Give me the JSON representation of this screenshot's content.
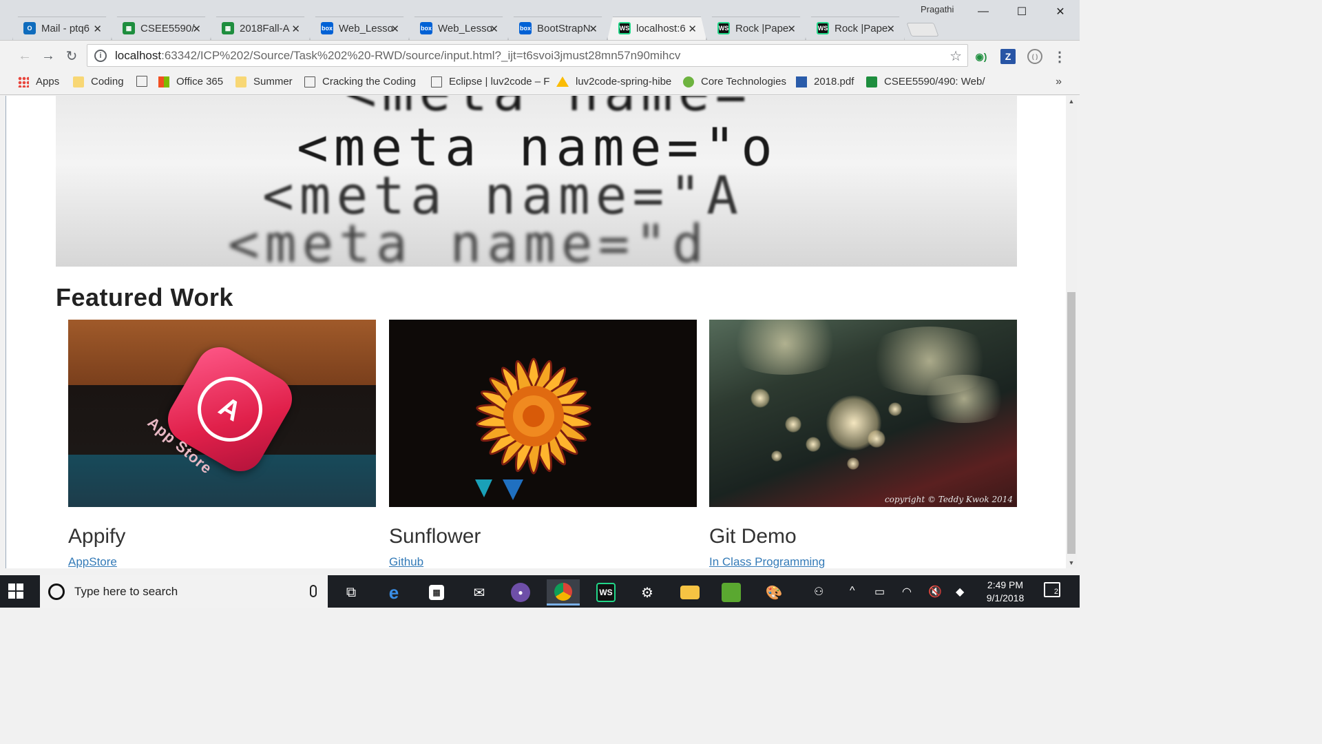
{
  "browser": {
    "profile_name": "Pragathi",
    "tabs": [
      {
        "title": "Mail - ptq6",
        "favicon": "outlook-icon"
      },
      {
        "title": "CSEE5590/",
        "favicon": "google-sheets-icon"
      },
      {
        "title": "2018Fall-A",
        "favicon": "google-sheets-icon"
      },
      {
        "title": "Web_Lesso",
        "favicon": "box-icon"
      },
      {
        "title": "Web_Lesso",
        "favicon": "box-icon"
      },
      {
        "title": "BootStrapN",
        "favicon": "box-icon"
      },
      {
        "title": "localhost:6",
        "favicon": "webstorm-icon"
      },
      {
        "title": "Rock |Pape",
        "favicon": "webstorm-icon"
      },
      {
        "title": "Rock |Pape",
        "favicon": "webstorm-icon"
      }
    ],
    "active_tab_index": 6,
    "url_host": "localhost",
    "url_rest": ":63342/ICP%202/Source/Task%202%20-RWD/source/input.html?_ijt=t6svoi3jmust28mn57n90mihcv",
    "bookmarks": [
      {
        "label": "Apps",
        "icon": "apps-grid-icon"
      },
      {
        "label": "Coding",
        "icon": "folder-icon"
      },
      {
        "label": "",
        "icon": "page-icon"
      },
      {
        "label": "Office 365",
        "icon": "office-icon"
      },
      {
        "label": "Summer",
        "icon": "folder-icon"
      },
      {
        "label": "Cracking the Coding",
        "icon": "page-icon"
      },
      {
        "label": "Eclipse | luv2code – F",
        "icon": "page-icon"
      },
      {
        "label": "luv2code-spring-hibe",
        "icon": "google-drive-icon"
      },
      {
        "label": "Core Technologies",
        "icon": "spring-leaf-icon"
      },
      {
        "label": "2018.pdf",
        "icon": "pdf-icon"
      },
      {
        "label": "CSEE5590/490: Web/",
        "icon": "google-sheets-icon"
      }
    ],
    "bookmarks_more": "»"
  },
  "page": {
    "hero_text": [
      "<meta  name=\"",
      "<meta  name=\"o",
      "<meta  name=\"A",
      "<meta  name=\"d"
    ],
    "section_title": "Featured Work",
    "cards": [
      {
        "title": "Appify",
        "link": "AppStore",
        "image_label": "App Store"
      },
      {
        "title": "Sunflower",
        "link": "Github",
        "image_label": ""
      },
      {
        "title": "Git Demo",
        "link": "In Class Programming",
        "image_label": "copyright © Teddy Kwok 2014"
      }
    ]
  },
  "taskbar": {
    "search_placeholder": "Type here to search",
    "time": "2:49 PM",
    "date": "9/1/2018",
    "notification_count": "2"
  },
  "colors": {
    "link": "#337ab7",
    "taskbar": "#1c1f24",
    "tabstrip": "#dcdfe3"
  }
}
